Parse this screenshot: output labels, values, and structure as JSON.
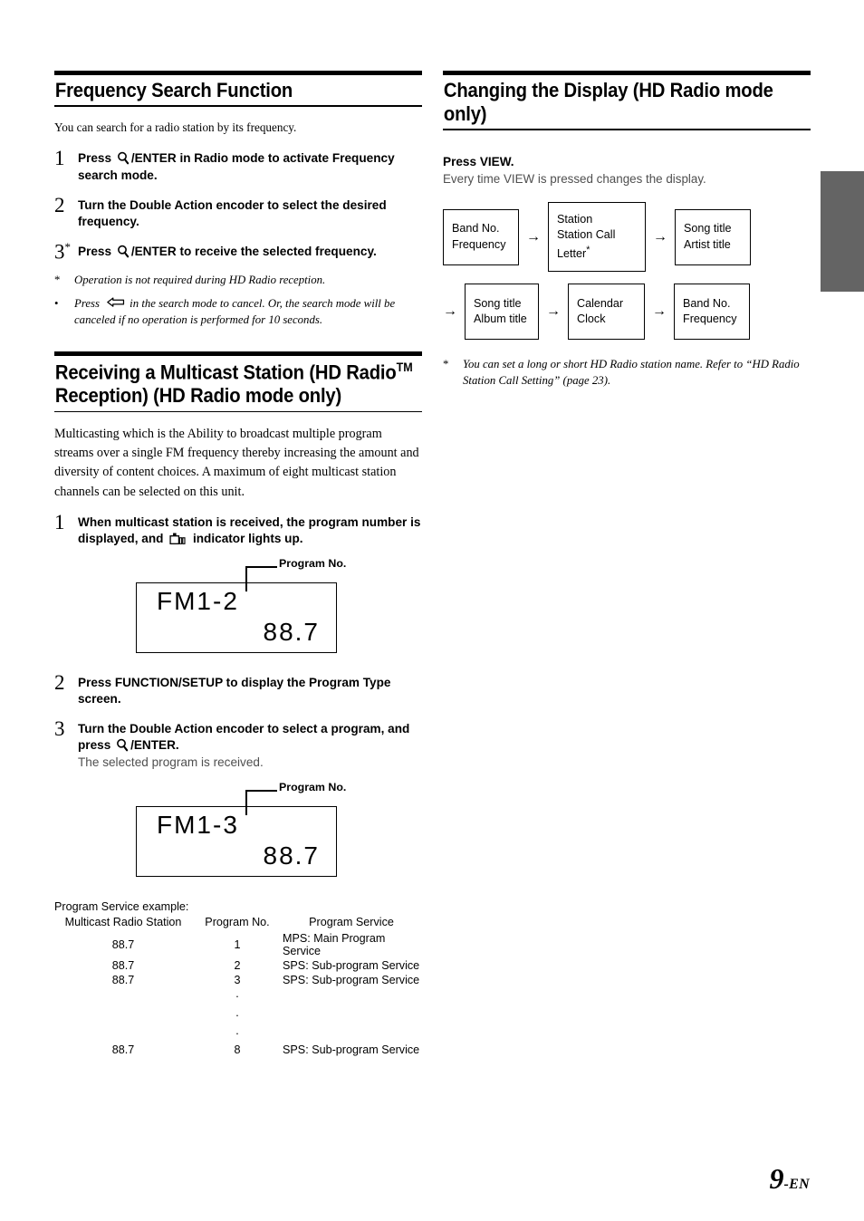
{
  "page": {
    "number": "9",
    "suffix": "-EN"
  },
  "left_column": {
    "section1": {
      "title": "Frequency Search Function",
      "intro": "You can search for a radio station by its frequency.",
      "steps": [
        {
          "num": "1",
          "text_before_icon": "Press ",
          "icon": "search-icon",
          "text_after_icon": "/ENTER in Radio mode to activate Frequency search mode."
        },
        {
          "num": "2",
          "text": "Turn the Double Action encoder to select the desired frequency.",
          "bold_run": "Double Action encoder"
        },
        {
          "num": "3",
          "marker": "*",
          "text_before_icon": "Press ",
          "icon": "search-icon",
          "text_after_icon": "/ENTER to receive the selected frequency."
        }
      ],
      "footnotes": [
        {
          "mark": "*",
          "text": "Operation is not required during HD Radio reception."
        },
        {
          "mark": "•",
          "text_before_icon": "Press ",
          "icon": "back-arrow-icon",
          "text_after_icon": "in the search mode to cancel. Or, the search mode will be canceled if no operation is performed for 10 seconds."
        }
      ]
    },
    "section2": {
      "title_part1": "Receiving a Multicast Station (HD Radio",
      "title_tm": "TM",
      "title_part2": " Reception) (HD Radio mode only)",
      "intro": "Multicasting which is the Ability to broadcast multiple program streams over a single FM frequency thereby increasing the amount and diversity of content choices. A maximum of eight multicast station channels can be selected on this unit.",
      "steps": [
        {
          "num": "1",
          "text_before_icon": "When multicast station is received, the program number is displayed, and ",
          "icon": "multicast-indicator-icon",
          "text_after_icon": " indicator lights up."
        },
        {
          "num": "2",
          "text": "Press FUNCTION/SETUP to display the Program Type screen.",
          "bold_run": "FUNCTION/SETUP"
        },
        {
          "num": "3",
          "text_before_icon": "Turn the Double Action encoder to select a program, and press ",
          "icon": "search-icon",
          "text_after_icon": "/ENTER.",
          "sub": "The selected program is received."
        }
      ],
      "display1": {
        "callout": "Program No.",
        "line1": "FM1-2",
        "line2": "88.7"
      },
      "display2": {
        "callout": "Program No.",
        "line1": "FM1-3",
        "line2": "88.7"
      },
      "table": {
        "caption": "Program Service example:",
        "headers": [
          "Multicast Radio Station",
          "Program No.",
          "Program Service"
        ],
        "rows": [
          [
            "88.7",
            "1",
            "MPS: Main Program Service"
          ],
          [
            "88.7",
            "2",
            "SPS: Sub-program Service"
          ],
          [
            "88.7",
            "3",
            "SPS: Sub-program Service"
          ],
          [
            "",
            "·",
            ""
          ],
          [
            "",
            "·",
            ""
          ],
          [
            "",
            "·",
            ""
          ],
          [
            "88.7",
            "8",
            "SPS: Sub-program Service"
          ]
        ]
      }
    }
  },
  "right_column": {
    "section1": {
      "title": "Changing the Display (HD Radio mode only)",
      "lead_bold": "Press VIEW.",
      "lead_sub": "Every time VIEW is pressed changes the display.",
      "flow": {
        "row1": [
          {
            "line1": "Band No.",
            "line2": "Frequency"
          },
          {
            "line1": "Station",
            "line2": "Station Call Letter",
            "asterisk": "*"
          },
          {
            "line1": "Song title",
            "line2": "Artist title"
          }
        ],
        "row2": [
          {
            "line1": "Song title",
            "line2": "Album title"
          },
          {
            "line1": "Calendar",
            "line2": "Clock"
          },
          {
            "line1": "Band No.",
            "line2": "Frequency"
          }
        ],
        "arrow_glyph": "→"
      },
      "footnote": {
        "mark": "*",
        "text": "You can set a long or short HD Radio station name. Refer to “HD Radio Station Call Setting” (page 23)."
      }
    }
  },
  "colors": {
    "edge_tab": "#646464",
    "rule": "#000000",
    "sub_text": "#4f4f4f"
  }
}
